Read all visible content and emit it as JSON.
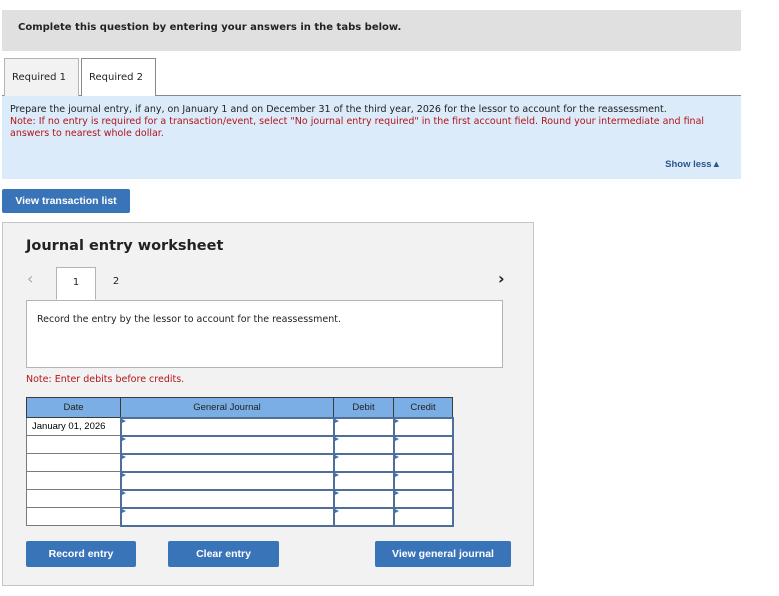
{
  "header": {
    "instruction": "Complete this question by entering your answers in the tabs below."
  },
  "tabs": [
    {
      "label": "Required 1",
      "active": false
    },
    {
      "label": "Required 2",
      "active": true
    }
  ],
  "instructions": {
    "main": "Prepare the journal entry, if any, on January 1 and on December 31 of the third year, 2026 for the lessor to account for the reassessment.",
    "note": "Note: If no entry is required for a transaction/event, select \"No journal entry required\" in the first account field. Round your intermediate and final answers to nearest whole dollar.",
    "show_less": "Show less▲"
  },
  "view_transaction_list": "View transaction list",
  "worksheet": {
    "title": "Journal entry worksheet",
    "prev_icon": "‹",
    "next_icon": "›",
    "pages": [
      "1",
      "2"
    ],
    "active_page": "1",
    "description": "Record the entry by the lessor to account for the reassessment.",
    "note": "Note: Enter debits before credits.",
    "table": {
      "headers": [
        "Date",
        "General Journal",
        "Debit",
        "Credit"
      ],
      "rows": [
        {
          "date": "January 01, 2026",
          "account": "",
          "debit": "",
          "credit": ""
        },
        {
          "date": "",
          "account": "",
          "debit": "",
          "credit": ""
        },
        {
          "date": "",
          "account": "",
          "debit": "",
          "credit": ""
        },
        {
          "date": "",
          "account": "",
          "debit": "",
          "credit": ""
        },
        {
          "date": "",
          "account": "",
          "debit": "",
          "credit": ""
        },
        {
          "date": "",
          "account": "",
          "debit": "",
          "credit": ""
        }
      ]
    },
    "buttons": {
      "record": "Record entry",
      "clear": "Clear entry",
      "view_journal": "View general journal"
    }
  },
  "colors": {
    "accent": "#3a74b8",
    "note_red": "#b3141b",
    "header_blue": "#7aaee4",
    "info_bg": "#dbebf9"
  }
}
